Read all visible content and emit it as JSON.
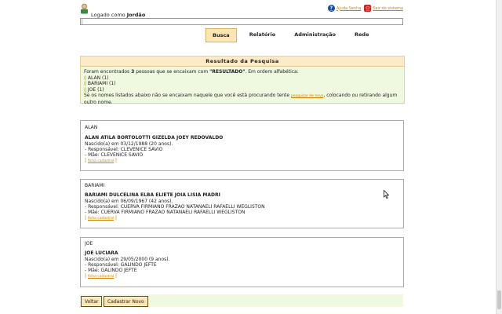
{
  "header": {
    "logged_prefix": "Logado como ",
    "user": "Jordão",
    "help_link": "Ajuda Senha",
    "exit_link": "Sair do sistema"
  },
  "nav": {
    "tabs": [
      "Busca",
      "Relatório",
      "Administração",
      "Rede"
    ],
    "active": "Busca"
  },
  "results": {
    "title": "Resultado da Pesquisa",
    "summary_prefix": "Foram encontrados ",
    "count": "3",
    "summary_mid": " pessoas que se encaixam com ",
    "query": "\"RESULTADO\"",
    "summary_suffix": ". Em ordem alfabética:",
    "groups": [
      "ALAN (1)",
      "BARIAMI (1)",
      "JOE (1)"
    ],
    "hint_prefix": "Se os nomes listados abaixo não se encaixam naquele que você está procurando tente ",
    "hint_link": "pesquisar de novo",
    "hint_suffix": ", colocando ou retirando algum outro nome."
  },
  "people": [
    {
      "group": "ALAN",
      "name": "ALAN ATILA BORTOLOTTI GIZELDA JOEY REDOVALDO",
      "birth": "Nascido(a) em 03/12/1988 (20 anos).",
      "responsible": "- Responsável: CLEVENICE SAVIO",
      "mother": "- Mãe: CLEVENICE SAVIO",
      "link": "ficha cadastral"
    },
    {
      "group": "BARIAMI",
      "name": "BARIAMI DULCELINA ELBA ELIETE JOIA LISIA MADRI",
      "birth": "Nascido(a) em 06/09/1967 (42 anos).",
      "responsible": "- Responsável: CUERVA FIRMIANO FRAZAO NATANAELI RAFAELLI WEGLISTON",
      "mother": "- Mãe: CUERVA FIRMIANO FRAZAO NATANAELI RAFAELLI WEGLISTON",
      "link": "ficha cadastral"
    },
    {
      "group": "JOE",
      "name": "JOE LUCIARA",
      "birth": "Nascido(a) em 29/05/2000 (9 anos).",
      "responsible": "- Responsável: GALINDO JEFTE",
      "mother": "- Mãe: GALINDO JEFTE",
      "link": "ficha cadastral"
    }
  ],
  "buttons": {
    "back": "Voltar",
    "new": "Cadastrar Novo"
  },
  "colors": {
    "accent": "#fde5b4",
    "panel": "#eff9e0",
    "link": "#d08000"
  }
}
